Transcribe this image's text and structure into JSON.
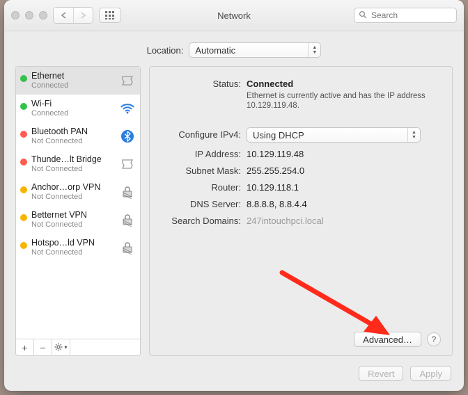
{
  "window": {
    "title": "Network"
  },
  "toolbar": {
    "search_placeholder": "Search"
  },
  "location": {
    "label": "Location:",
    "value": "Automatic"
  },
  "sidebar": {
    "services": [
      {
        "name": "Ethernet",
        "sub": "Connected",
        "status": "green",
        "icon": "ethernet",
        "selected": true
      },
      {
        "name": "Wi-Fi",
        "sub": "Connected",
        "status": "green",
        "icon": "wifi",
        "selected": false
      },
      {
        "name": "Bluetooth PAN",
        "sub": "Not Connected",
        "status": "red",
        "icon": "bluetooth",
        "selected": false
      },
      {
        "name": "Thunde…lt Bridge",
        "sub": "Not Connected",
        "status": "red",
        "icon": "ethernet",
        "selected": false
      },
      {
        "name": "Anchor…orp VPN",
        "sub": "Not Connected",
        "status": "yellow",
        "icon": "lock",
        "selected": false
      },
      {
        "name": "Betternet VPN",
        "sub": "Not Connected",
        "status": "yellow",
        "icon": "lock",
        "selected": false
      },
      {
        "name": "Hotspo…ld VPN",
        "sub": "Not Connected",
        "status": "yellow",
        "icon": "lock",
        "selected": false
      }
    ]
  },
  "detail": {
    "status_label": "Status:",
    "status_value": "Connected",
    "status_desc": "Ethernet is currently active and has the IP address 10.129.119.48.",
    "configure_label": "Configure IPv4:",
    "configure_value": "Using DHCP",
    "ip_label": "IP Address:",
    "ip_value": "10.129.119.48",
    "subnet_label": "Subnet Mask:",
    "subnet_value": "255.255.254.0",
    "router_label": "Router:",
    "router_value": "10.129.118.1",
    "dns_label": "DNS Server:",
    "dns_value": "8.8.8.8, 8.8.4.4",
    "search_label": "Search Domains:",
    "search_value": "247intouchpci.local",
    "advanced_label": "Advanced…"
  },
  "footer": {
    "revert": "Revert",
    "apply": "Apply"
  },
  "annotation": {
    "arrow_color": "#ff2a1a"
  }
}
